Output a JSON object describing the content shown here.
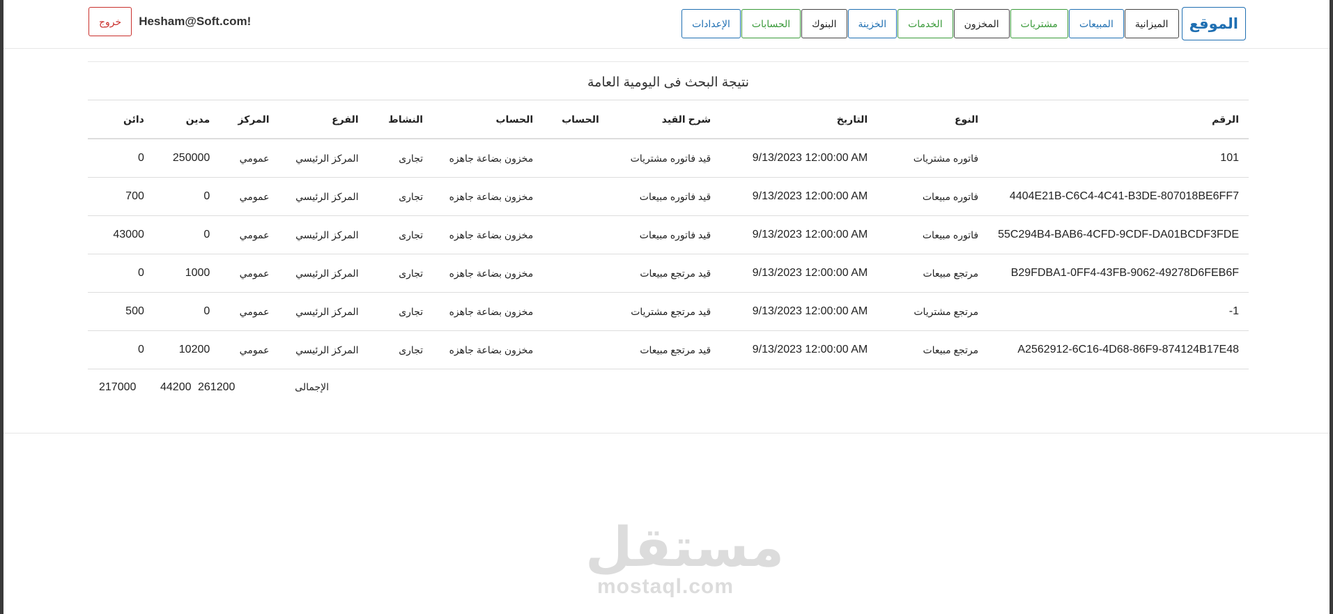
{
  "nav": {
    "brand": "الموقع",
    "items": [
      {
        "label": "الميزانية",
        "color": "#222222"
      },
      {
        "label": "المبيعات",
        "color": "#1f6fb2"
      },
      {
        "label": "مشتريات",
        "color": "#3a9a3a"
      },
      {
        "label": "المخزون",
        "color": "#222222"
      },
      {
        "label": "الخدمات",
        "color": "#3a9a3a"
      },
      {
        "label": "الخزينة",
        "color": "#1f6fb2"
      },
      {
        "label": "البنوك",
        "color": "#222222"
      },
      {
        "label": "الحسابات",
        "color": "#3a9a3a"
      },
      {
        "label": "الإعدادات",
        "color": "#1f6fb2"
      }
    ],
    "user_email": "Hesham@Soft.com!",
    "logout_label": "خروج"
  },
  "report": {
    "caption": "نتيجة البحث فى اليومية العامة",
    "columns": [
      "الرقم",
      "النوع",
      "التاريخ",
      "شرح القيد",
      "الحساب",
      "الحساب",
      "النشاط",
      "الفرع",
      "المركز",
      "مدين",
      "دائن"
    ],
    "rows": [
      [
        "101",
        "فاتوره مشتريات",
        "9/13/2023 12:00:00 AM",
        "قيد فاتوره مشتريات",
        "",
        "مخزون بضاعة جاهزه",
        "تجارى",
        "المركز الرئيسي",
        "عمومي",
        "250000",
        "0"
      ],
      [
        "4404E21B-C6C4-4C41-B3DE-807018BE6FF7",
        "فاتوره مبيعات",
        "9/13/2023 12:00:00 AM",
        "قيد فاتوره مبيعات",
        "",
        "مخزون بضاعة جاهزه",
        "تجارى",
        "المركز الرئيسي",
        "عمومي",
        "0",
        "700"
      ],
      [
        "55C294B4-BAB6-4CFD-9CDF-DA01BCDF3FDE",
        "فاتوره مبيعات",
        "9/13/2023 12:00:00 AM",
        "قيد فاتوره مبيعات",
        "",
        "مخزون بضاعة جاهزه",
        "تجارى",
        "المركز الرئيسي",
        "عمومي",
        "0",
        "43000"
      ],
      [
        "B29FDBA1-0FF4-43FB-9062-49278D6FEB6F",
        "مرتجع مبيعات",
        "9/13/2023 12:00:00 AM",
        "قيد مرتجع مبيعات",
        "",
        "مخزون بضاعة جاهزه",
        "تجارى",
        "المركز الرئيسي",
        "عمومي",
        "1000",
        "0"
      ],
      [
        "-1",
        "مرتجع مشتريات",
        "9/13/2023 12:00:00 AM",
        "قيد مرتجع مشتريات",
        "",
        "مخزون بضاعة جاهزه",
        "تجارى",
        "المركز الرئيسي",
        "عمومي",
        "0",
        "500"
      ],
      [
        "A2562912-6C16-4D68-86F9-874124B17E48",
        "مرتجع مبيعات",
        "9/13/2023 12:00:00 AM",
        "قيد مرتجع مبيعات",
        "",
        "مخزون بضاعة جاهزه",
        "تجارى",
        "المركز الرئيسي",
        "عمومي",
        "10200",
        "0"
      ]
    ],
    "totals": {
      "label": "الإجمالى",
      "debit": "261200",
      "credit": "44200",
      "difference": "217000"
    }
  },
  "watermark": {
    "arabic": "مستقل",
    "latin": "mostaql.com"
  }
}
